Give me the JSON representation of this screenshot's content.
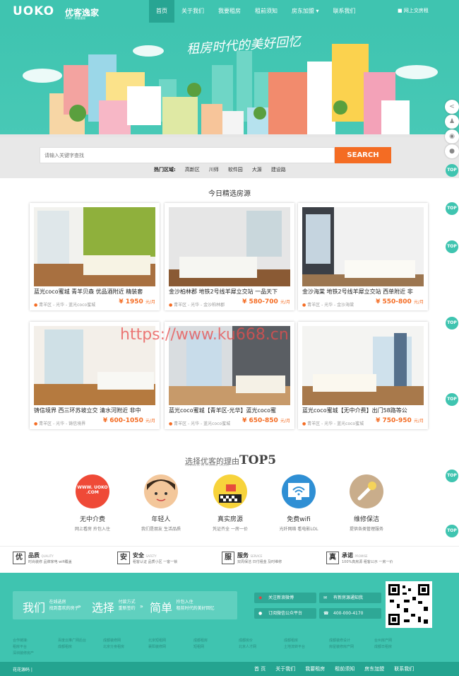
{
  "header": {
    "logo": "UOKO",
    "logo_cn": "优客逸家",
    "logo_sub": "COM · 优客逸家",
    "nav": [
      "首页",
      "关于我们",
      "我要租房",
      "租前须知",
      "房东加盟 ▾",
      "联系我们"
    ],
    "login": "网上交房租"
  },
  "banner": {
    "slogan": "租房时代的美好回忆"
  },
  "search": {
    "placeholder": "请输入关键字查找",
    "button": "SEARCH",
    "hot_label": "热门区域:",
    "hot_areas": [
      "高新区",
      "川师",
      "软件园",
      "大源",
      "建设路"
    ]
  },
  "listings": {
    "title": "今日精选房源",
    "items": [
      {
        "title": "蓝光coco蜜城 青羊贝森 优品酒附近 精装套",
        "location": "青羊区 - 光华 - 蓝光coco蜜城",
        "price": "¥ 1950",
        "unit": "元/月"
      },
      {
        "title": "金沙柏林郡 地铁2号线羊犀立交站 一品天下",
        "location": "青羊区 - 光华 - 金沙柏林郡",
        "price": "¥ 580-700",
        "unit": "元/月"
      },
      {
        "title": "金沙海棠 地铁2号线羊犀立交站 西单附近 非",
        "location": "青羊区 - 光华 - 金沙海棠",
        "price": "¥ 550-800",
        "unit": "元/月"
      },
      {
        "title": "铸信境界 西三环苏坡立交 清水河附近 非中",
        "location": "青羊区 - 光华 - 铸信境界",
        "price": "¥ 600-1050",
        "unit": "元/月"
      },
      {
        "title": "蓝光coco蜜城【青羊区-光华】蓝光coco蜜",
        "location": "青羊区 - 光华 - 蓝光coco蜜城",
        "price": "¥ 650-850",
        "unit": "元/月"
      },
      {
        "title": "蓝光coco蜜城【无中介费】出门58路等公",
        "location": "青羊区 - 光华 - 蓝光coco蜜城",
        "price": "¥ 750-950",
        "unit": "元/月"
      }
    ]
  },
  "watermark": "https://www.ku668.cn",
  "reasons": {
    "title_pre": "选择优客的理由",
    "title_top": "TOP5",
    "subtitle": "Reasons to choose UOKO",
    "items": [
      {
        "title": "无中介费",
        "desc": "网上看房 拎包入住",
        "badge": "WWW. UOKO .COM"
      },
      {
        "title": "年轻人",
        "desc": "我们是朋友 生活品质"
      },
      {
        "title": "真实房源",
        "desc": "凭证齐全 一房一价"
      },
      {
        "title": "免费wifi",
        "desc": "光纤网络 看电影LOL"
      },
      {
        "title": "维修保洁",
        "desc": "提供各类管理服务"
      }
    ]
  },
  "quality": [
    {
      "icon": "优",
      "title": "品质",
      "en": "QUALITY",
      "desc": "时尚装修  品牌家电  wifi覆盖"
    },
    {
      "icon": "安",
      "title": "安全",
      "en": "SAFETY",
      "desc": "租客认证  品质小区  一客一锁"
    },
    {
      "icon": "服",
      "title": "服务",
      "en": "SERVICE",
      "desc": "双周保洁  日付租金  及时维修"
    },
    {
      "icon": "真",
      "title": "承诺",
      "en": "PROMISE",
      "desc": "100%真房源  租客公示  一房一价"
    }
  ],
  "footer": {
    "promo": [
      {
        "big": "我们",
        "sm1": "在线选房",
        "sm2": "找到喜欢的房子"
      },
      {
        "big": "选择",
        "sm1": "付款方式",
        "sm2": "重新签约"
      },
      {
        "big": "简单",
        "sm1": "拎包入住",
        "sm2": "租前时代的美好回忆"
      }
    ],
    "buttons": [
      "关注新浪微博",
      "有新房源通知我",
      "订阅微信公众平台",
      "400-000-4170"
    ],
    "links": [
      "合作链接:",
      "百度云推广网后台",
      "成都装修网",
      "北京短租网",
      "成都租房",
      "成都房价",
      "成都租房",
      "成都装修设计",
      "台州房产网",
      "租房平台",
      "成都租房",
      "北京分身租房",
      "襄阳装修网",
      "短租网",
      "北京人才网",
      "土地流转平台",
      "房屋装修房产网",
      "成都日租房",
      "深圳装修房产"
    ],
    "copyright": "花花源码 |",
    "bottom_nav": [
      "首 页",
      "关于我们",
      "我要租房",
      "租前须知",
      "房东加盟",
      "联系我们"
    ]
  },
  "side": {
    "top_label": "TOP"
  },
  "colors": {
    "brand": "#3fc4b0",
    "accent": "#f46c23",
    "dark": "#24a490"
  }
}
